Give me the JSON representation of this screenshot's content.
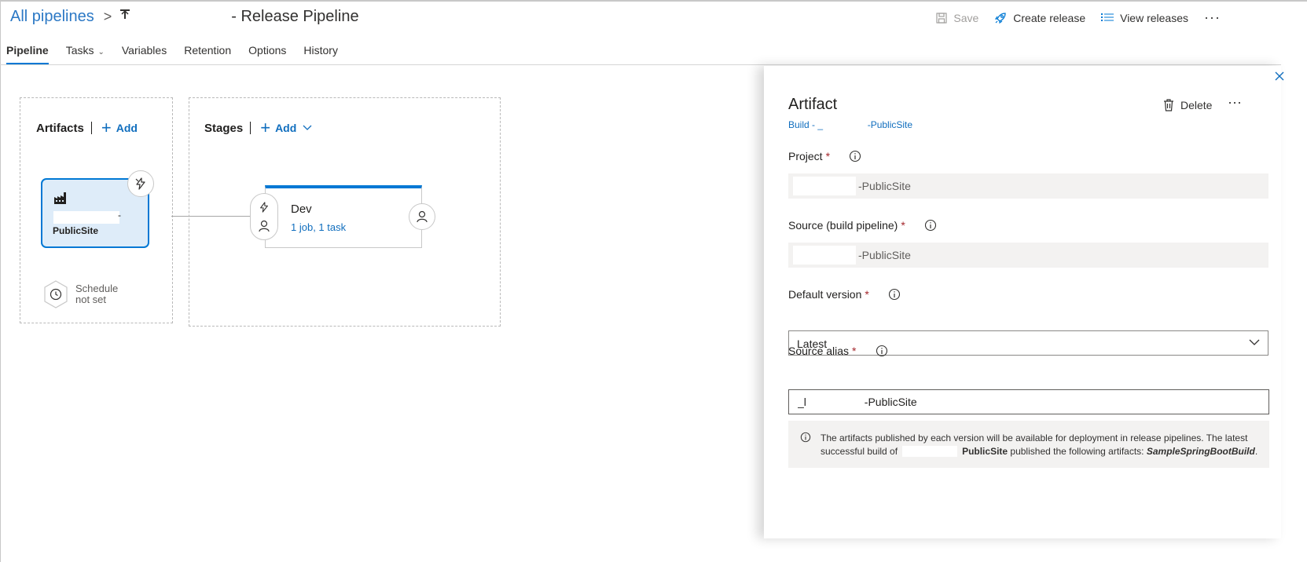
{
  "header": {
    "breadcrumb_root": "All pipelines",
    "breadcrumb_sep": ">",
    "pipeline_title": "- Release Pipeline",
    "actions": {
      "save": "Save",
      "create_release": "Create release",
      "view_releases": "View releases",
      "more": "···"
    }
  },
  "tabs": [
    {
      "label": "Pipeline"
    },
    {
      "label": "Tasks"
    },
    {
      "label": "Variables"
    },
    {
      "label": "Retention"
    },
    {
      "label": "Options"
    },
    {
      "label": "History"
    }
  ],
  "canvas": {
    "artifacts": {
      "title": "Artifacts",
      "add_label": "Add",
      "card": {
        "dash": "-",
        "name": "PublicSite",
        "icon": "build-factory-icon"
      },
      "trigger_icon": "lightning-icon",
      "schedule": {
        "line1": "Schedule",
        "line2": "not set"
      }
    },
    "stages": {
      "title": "Stages",
      "add_label": "Add",
      "stage": {
        "name": "Dev",
        "info": "1 job, 1 task"
      }
    }
  },
  "panel": {
    "title": "Artifact",
    "subtitle": "Build - _                 -PublicSite",
    "delete_label": "Delete",
    "more": "···",
    "fields": {
      "project": {
        "label": "Project",
        "required": "*",
        "value": "-PublicSite"
      },
      "source": {
        "label": "Source (build pipeline)",
        "required": "*",
        "value": "-PublicSite"
      },
      "default_version": {
        "label": "Default version",
        "required": "*",
        "value": "Latest"
      },
      "source_alias": {
        "label": "Source alias",
        "required": "*",
        "value": "_l                   -PublicSite"
      }
    },
    "notice": {
      "line1": "The artifacts published by each version will be available for deployment in release pipelines. The latest",
      "line2_a": "successful build of",
      "line2_b": "PublicSite",
      "line2_c": " published the following artifacts: ",
      "artifact_name": "SampleSpringBootBuild",
      "period": "."
    }
  },
  "colors": {
    "accent": "#0078d4",
    "link": "#106ebe",
    "required": "#a4262c"
  }
}
